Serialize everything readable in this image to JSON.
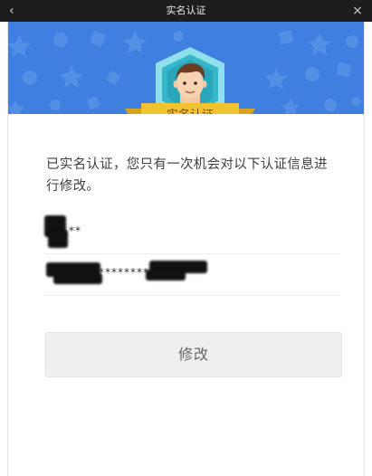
{
  "window": {
    "title": "实名认证",
    "back_icon": "‹",
    "close_icon": "×"
  },
  "badge": {
    "label": "实名认证"
  },
  "notice_text": "已实名认证，您只有一次机会对以下认证信息进行修改。",
  "fields": {
    "name_masked": "**",
    "id_masked": "********"
  },
  "button": {
    "label": "修改"
  },
  "colors": {
    "banner": "#3f7fdf",
    "badge_frame": "#36b7c9",
    "ribbon": "#f2c230",
    "button_bg": "#efefef"
  }
}
